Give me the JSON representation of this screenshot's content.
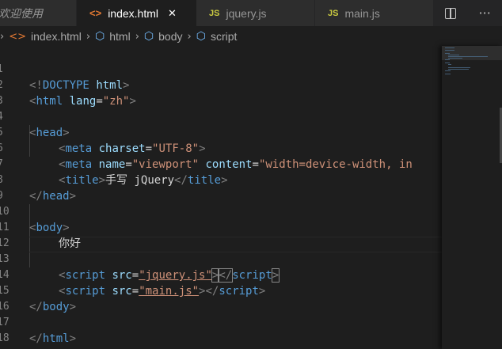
{
  "tabs": {
    "welcome": "欢迎使用",
    "index": {
      "label": "index.html",
      "close": "✕"
    },
    "jquery": {
      "icon": "JS",
      "label": "jquery.js"
    },
    "main": {
      "icon": "JS",
      "label": "main.js"
    }
  },
  "actions": {
    "more": "···"
  },
  "breadcrumb": {
    "file": "index.html",
    "items": [
      "html",
      "body",
      "script"
    ]
  },
  "code": {
    "l1": {
      "open": "<!",
      "kw": "DOCTYPE",
      "sp": " ",
      "name": "html",
      "close": ">"
    },
    "l2": {
      "open": "<",
      "tag": "html",
      "sp": " ",
      "attr": "lang",
      "eq": "=",
      "val": "\"zh\"",
      "close": ">"
    },
    "l4": {
      "open": "<",
      "tag": "head",
      "close": ">"
    },
    "l5": {
      "open": "<",
      "tag": "meta",
      "sp": " ",
      "attr": "charset",
      "eq": "=",
      "val": "\"UTF-8\"",
      "close": ">"
    },
    "l6": {
      "open": "<",
      "tag": "meta",
      "sp": " ",
      "attr1": "name",
      "eq1": "=",
      "val1": "\"viewport\"",
      "sp2": " ",
      "attr2": "content",
      "eq2": "=",
      "val2": "\"width=device-width, in"
    },
    "l7": {
      "open": "<",
      "tag": "title",
      "close": ">",
      "text": "手写 jQuery",
      "end_open": "</",
      "end_tag": "title",
      "end_close": ">"
    },
    "l8": {
      "open": "</",
      "tag": "head",
      "close": ">"
    },
    "l10": {
      "open": "<",
      "tag": "body",
      "close": ">"
    },
    "l11": {
      "text": "你好"
    },
    "l13": {
      "open": "<",
      "tag": "script",
      "sp": " ",
      "attr": "src",
      "eq": "=",
      "val": "\"jquery.js\"",
      "close": ">",
      "end_open": "</",
      "end_tag": "script",
      "end_close": ">"
    },
    "l14": {
      "open": "<",
      "tag": "script",
      "sp": " ",
      "attr": "src",
      "eq": "=",
      "val": "\"main.js\"",
      "close": ">",
      "end_open": "</",
      "end_tag": "script",
      "end_close": ">"
    },
    "l15": {
      "open": "</",
      "tag": "body",
      "close": ">"
    },
    "l17": {
      "open": "</",
      "tag": "html",
      "close": ">"
    }
  },
  "line_numbers": [
    "1",
    "2",
    "3",
    "4",
    "5",
    "6",
    "7",
    "8",
    "9",
    "10",
    "11",
    "12",
    "13",
    "14",
    "15",
    "16",
    "17",
    "18"
  ],
  "colors": {
    "editor_bg": "#1e1e1e",
    "tag": "#569cd6",
    "attr": "#9cdcfe",
    "string": "#ce9178",
    "punctuation": "#808080"
  }
}
